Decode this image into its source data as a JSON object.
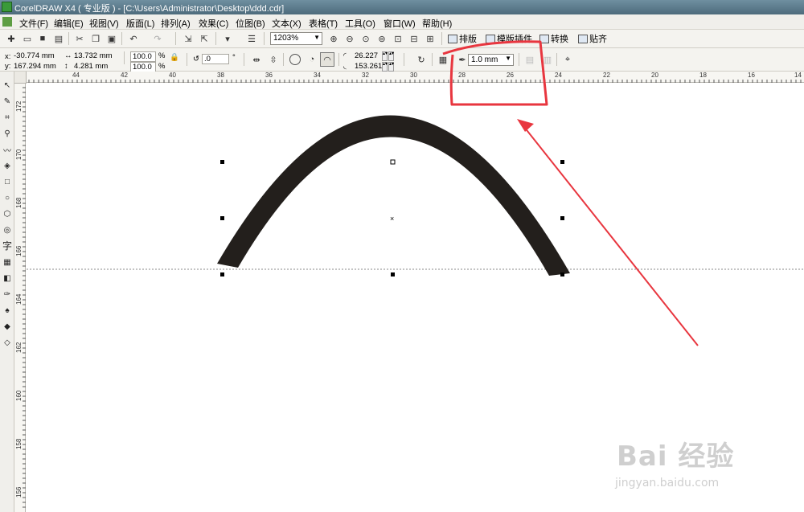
{
  "window": {
    "title": "CorelDRAW X4 ( 专业版 ) - [C:\\Users\\Administrator\\Desktop\\ddd.cdr]"
  },
  "menu": {
    "items": [
      "文件(F)",
      "编辑(E)",
      "视图(V)",
      "版面(L)",
      "排列(A)",
      "效果(C)",
      "位图(B)",
      "文本(X)",
      "表格(T)",
      "工具(O)",
      "窗口(W)",
      "帮助(H)"
    ]
  },
  "standard_toolbar": {
    "zoom_level": "1203%",
    "layout_label": "排版",
    "plugin_label": "模版插件",
    "convert_label": "转换",
    "snap_label": "贴齐"
  },
  "property_bar": {
    "x_label": "x:",
    "x_value": "-30.774 mm",
    "y_label": "y:",
    "y_value": "167.294 mm",
    "width_value": "13.732 mm",
    "height_value": "4.281 mm",
    "scale_x": "100.0",
    "scale_y": "100.0",
    "percent": "%",
    "rotation": ".0",
    "degree": "°",
    "start_angle": "26.227",
    "end_angle": "153.261",
    "outline_width": "1.0 mm"
  },
  "ruler": {
    "horizontal_labels": [
      "44",
      "42",
      "40",
      "38",
      "36",
      "34",
      "32",
      "30",
      "28",
      "26",
      "24",
      "22",
      "20",
      "18",
      "16",
      "14"
    ],
    "vertical_labels": [
      "172",
      "170",
      "168",
      "166",
      "164",
      "162",
      "160",
      "158",
      "156"
    ]
  },
  "canvas": {
    "shape_color": "#231f1c",
    "annotation_color": "#e8363f",
    "guide_color": "#8a8a8a"
  },
  "watermark": {
    "logo_text": "Bai 经验",
    "url_text": "jingyan.baidu.com"
  }
}
